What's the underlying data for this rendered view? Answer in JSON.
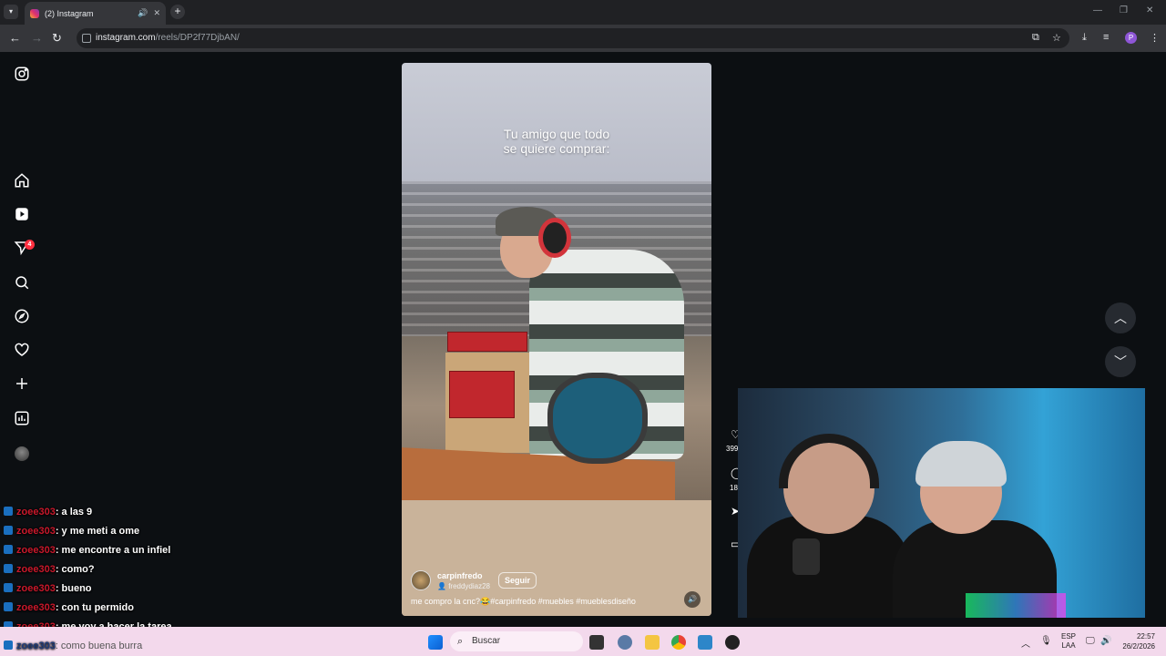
{
  "browser": {
    "tab_title": "(2) Instagram",
    "url_host": "instagram.com",
    "url_path": "/reels/DP2f77DjbAN/"
  },
  "sidebar": {
    "notification_count": "4"
  },
  "reel": {
    "overlay_text_line1": "Tu amigo que todo",
    "overlay_text_line2": "se quiere comprar:",
    "username": "carpinfredo",
    "collaborator": "freddydiaz28",
    "follow_label": "Seguir",
    "description": "me compro la cnc?😂#carpinfredo #muebles #mueblesdiseño",
    "likes": "399",
    "comments": "18"
  },
  "chat": [
    {
      "user": "zoee303",
      "message": ": a las 9"
    },
    {
      "user": "zoee303",
      "message": ": y me meti a ome"
    },
    {
      "user": "zoee303",
      "message": ": me encontre a un infiel"
    },
    {
      "user": "zoee303",
      "message": ": como?"
    },
    {
      "user": "zoee303",
      "message": ": bueno"
    },
    {
      "user": "zoee303",
      "message": ": con tu permido"
    },
    {
      "user": "zoee303",
      "message": ": me voy a hacer la tarea"
    },
    {
      "user": "zoee303",
      "message": ": como buena burra"
    }
  ],
  "taskbar": {
    "search_placeholder": "Buscar",
    "lang_line1": "ESP",
    "lang_line2": "LAA",
    "time": "22:57",
    "date": "26/2/2026"
  },
  "colors": {
    "chat_user": "#c9182b",
    "badge": "#ff3040",
    "taskbar_bg": "#f3d9ec"
  }
}
